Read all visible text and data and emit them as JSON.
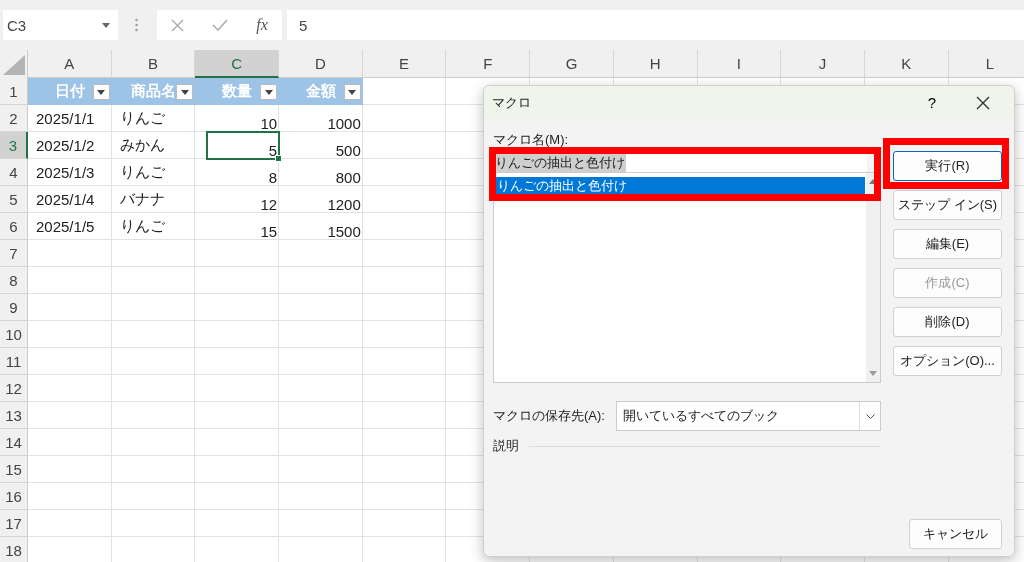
{
  "formula_bar": {
    "name_box": "C3",
    "function_label": "fx",
    "value": "5"
  },
  "columns": [
    {
      "label": "A",
      "selected": false
    },
    {
      "label": "B",
      "selected": false
    },
    {
      "label": "C",
      "selected": true
    },
    {
      "label": "D",
      "selected": false
    },
    {
      "label": "E",
      "selected": false
    },
    {
      "label": "F",
      "selected": false
    },
    {
      "label": "G",
      "selected": false
    },
    {
      "label": "H",
      "selected": false
    },
    {
      "label": "I",
      "selected": false
    },
    {
      "label": "J",
      "selected": false
    },
    {
      "label": "K",
      "selected": false
    },
    {
      "label": "L",
      "selected": false
    }
  ],
  "rows": [
    {
      "label": "1",
      "selected": false
    },
    {
      "label": "2",
      "selected": false
    },
    {
      "label": "3",
      "selected": true
    },
    {
      "label": "4",
      "selected": false
    },
    {
      "label": "5",
      "selected": false
    },
    {
      "label": "6",
      "selected": false
    },
    {
      "label": "7",
      "selected": false
    },
    {
      "label": "8",
      "selected": false
    },
    {
      "label": "9",
      "selected": false
    },
    {
      "label": "10",
      "selected": false
    },
    {
      "label": "11",
      "selected": false
    },
    {
      "label": "12",
      "selected": false
    },
    {
      "label": "13",
      "selected": false
    },
    {
      "label": "14",
      "selected": false
    },
    {
      "label": "15",
      "selected": false
    },
    {
      "label": "16",
      "selected": false
    },
    {
      "label": "17",
      "selected": false
    },
    {
      "label": "18",
      "selected": false
    }
  ],
  "table": {
    "headers": [
      {
        "text": "日付",
        "kind": "text"
      },
      {
        "text": "商品名",
        "kind": "text"
      },
      {
        "text": "数量",
        "kind": "number"
      },
      {
        "text": "金額",
        "kind": "number"
      }
    ],
    "rows": [
      {
        "cells": [
          {
            "text": "2025/1/1",
            "selected": false
          },
          {
            "text": "りんご",
            "selected": false
          },
          {
            "text": "10",
            "selected": false
          },
          {
            "text": "1000",
            "selected": false
          }
        ]
      },
      {
        "cells": [
          {
            "text": "2025/1/2",
            "selected": false
          },
          {
            "text": "みかん",
            "selected": false
          },
          {
            "text": "5",
            "selected": true
          },
          {
            "text": "500",
            "selected": false
          }
        ]
      },
      {
        "cells": [
          {
            "text": "2025/1/3",
            "selected": false
          },
          {
            "text": "りんご",
            "selected": false
          },
          {
            "text": "8",
            "selected": false
          },
          {
            "text": "800",
            "selected": false
          }
        ]
      },
      {
        "cells": [
          {
            "text": "2025/1/4",
            "selected": false
          },
          {
            "text": "バナナ",
            "selected": false
          },
          {
            "text": "12",
            "selected": false
          },
          {
            "text": "1200",
            "selected": false
          }
        ]
      },
      {
        "cells": [
          {
            "text": "2025/1/5",
            "selected": false
          },
          {
            "text": "りんご",
            "selected": false
          },
          {
            "text": "15",
            "selected": false
          },
          {
            "text": "1500",
            "selected": false
          }
        ]
      }
    ]
  },
  "dialog": {
    "title": "マクロ",
    "help": "?",
    "macro_name_label": "マクロ名(M):",
    "macro_name_value": "りんごの抽出と色付け",
    "name_area_highlighted": true,
    "macro_list": [
      {
        "name": "りんごの抽出と色付け",
        "selected": true
      }
    ],
    "buttons": [
      {
        "label": "実行(R)",
        "disabled": false,
        "highlighted": true
      },
      {
        "label": "ステップ イン(S)",
        "disabled": false,
        "highlighted": false
      },
      {
        "label": "編集(E)",
        "disabled": false,
        "highlighted": false
      },
      {
        "label": "作成(C)",
        "disabled": true,
        "highlighted": false
      },
      {
        "label": "削除(D)",
        "disabled": false,
        "highlighted": false
      },
      {
        "label": "オプション(O)...",
        "disabled": false,
        "highlighted": false
      }
    ],
    "location_label": "マクロの保存先(A):",
    "location_value": "開いているすべてのブック",
    "description_label": "説明",
    "cancel": "キャンセル"
  }
}
